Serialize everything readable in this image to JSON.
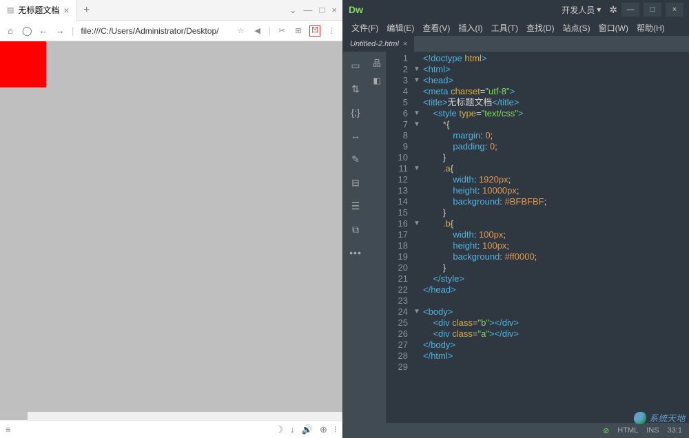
{
  "browser": {
    "tab_title": "无标题文档",
    "new_tab": "+",
    "tab_close": "×",
    "win_controls": {
      "restore": "⌄",
      "min": "—",
      "max": "□",
      "close": "×"
    },
    "nav": {
      "home": "⌂",
      "reload": "◯",
      "back": "←",
      "fwd": "→"
    },
    "url": "file:///C:/Users/Administrator/Desktop/",
    "addr_icons": {
      "star": "☆",
      "cut": "✂",
      "grid": "⊞",
      "pdf": "凹",
      "more": "⋮",
      "block": "◀"
    },
    "status": {
      "menu": "≡",
      "moon": "☽",
      "dl": "↓",
      "vol": "🔊",
      "zoom": "⊕",
      "more": "⁝"
    }
  },
  "dw": {
    "logo": "Dw",
    "workspace": "开发人员",
    "gear": "✲",
    "win": {
      "min": "—",
      "max": "□",
      "close": "×"
    },
    "menu": [
      "文件(F)",
      "编辑(E)",
      "查看(V)",
      "插入(I)",
      "工具(T)",
      "查找(D)",
      "站点(S)",
      "窗口(W)",
      "帮助(H)"
    ],
    "doc_tab": "Untitled-2.html",
    "doc_close": "×",
    "tools": [
      "▭",
      "⇅",
      "{;}",
      "↔",
      "✎",
      "⊟",
      "☰",
      "⧉"
    ],
    "tools_dots": "•••",
    "gut2": [
      "品",
      "◧"
    ],
    "status": {
      "ok": "⊘",
      "lang": "HTML",
      "ins": "INS",
      "pos": "33:1"
    }
  },
  "code": {
    "lines": [
      {
        "n": 1,
        "f": "",
        "h": "<span class='t-tag'>&lt;!doctype</span> <span class='t-attr'>html</span><span class='t-tag'>&gt;</span>"
      },
      {
        "n": 2,
        "f": "▼",
        "h": "<span class='t-tag'>&lt;html&gt;</span>"
      },
      {
        "n": 3,
        "f": "▼",
        "h": "<span class='t-tag'>&lt;head&gt;</span>"
      },
      {
        "n": 4,
        "f": "",
        "h": "<span class='t-tag'>&lt;meta</span> <span class='t-attr'>charset</span>=<span class='t-str'>\"utf-8\"</span><span class='t-tag'>&gt;</span>"
      },
      {
        "n": 5,
        "f": "",
        "h": "<span class='t-tag'>&lt;title&gt;</span><span class='t-text'>无标题文档</span><span class='t-tag'>&lt;/title&gt;</span>"
      },
      {
        "n": 6,
        "f": "▼",
        "h": "    <span class='t-tag'>&lt;style</span> <span class='t-attr'>type</span>=<span class='t-str'>\"text/css\"</span><span class='t-tag'>&gt;</span>"
      },
      {
        "n": 7,
        "f": "▼",
        "h": "        <span class='t-sel'>*</span>{"
      },
      {
        "n": 8,
        "f": "",
        "h": "            <span class='t-prop'>margin</span>: <span class='t-num'>0</span>;"
      },
      {
        "n": 9,
        "f": "",
        "h": "            <span class='t-prop'>padding</span>: <span class='t-num'>0</span>;"
      },
      {
        "n": 10,
        "f": "",
        "h": "        }"
      },
      {
        "n": 11,
        "f": "▼",
        "h": "        <span class='t-sel'>.a</span>{"
      },
      {
        "n": 12,
        "f": "",
        "h": "            <span class='t-prop'>width</span>: <span class='t-num'>1920px</span>;"
      },
      {
        "n": 13,
        "f": "",
        "h": "            <span class='t-prop'>height</span>: <span class='t-num'>10000px</span>;"
      },
      {
        "n": 14,
        "f": "",
        "h": "            <span class='t-prop'>background</span>: <span class='t-val'>#BFBFBF</span>;"
      },
      {
        "n": 15,
        "f": "",
        "h": "        }"
      },
      {
        "n": 16,
        "f": "▼",
        "h": "        <span class='t-sel'>.b</span>{"
      },
      {
        "n": 17,
        "f": "",
        "h": "            <span class='t-prop'>width</span>: <span class='t-num'>100px</span>;"
      },
      {
        "n": 18,
        "f": "",
        "h": "            <span class='t-prop'>height</span>: <span class='t-num'>100px</span>;"
      },
      {
        "n": 19,
        "f": "",
        "h": "            <span class='t-prop'>background</span>: <span class='t-val'>#ff0000</span>;"
      },
      {
        "n": 20,
        "f": "",
        "h": "        }"
      },
      {
        "n": 21,
        "f": "",
        "h": "    <span class='t-tag'>&lt;/style&gt;</span>"
      },
      {
        "n": 22,
        "f": "",
        "h": "<span class='t-tag'>&lt;/head&gt;</span>"
      },
      {
        "n": 23,
        "f": "",
        "h": ""
      },
      {
        "n": 24,
        "f": "▼",
        "h": "<span class='t-tag'>&lt;body&gt;</span>"
      },
      {
        "n": 25,
        "f": "",
        "h": "    <span class='t-tag'>&lt;div</span> <span class='t-attr'>class</span>=<span class='t-str'>\"b\"</span><span class='t-tag'>&gt;&lt;/div&gt;</span>"
      },
      {
        "n": 26,
        "f": "",
        "h": "    <span class='t-tag'>&lt;div</span> <span class='t-attr'>class</span>=<span class='t-str'>\"a\"</span><span class='t-tag'>&gt;&lt;/div&gt;</span>"
      },
      {
        "n": 27,
        "f": "",
        "h": "<span class='t-tag'>&lt;/body&gt;</span>"
      },
      {
        "n": 28,
        "f": "",
        "h": "<span class='t-tag'>&lt;/html&gt;</span>"
      },
      {
        "n": 29,
        "f": "",
        "h": ""
      }
    ]
  },
  "watermark": "系统天地"
}
